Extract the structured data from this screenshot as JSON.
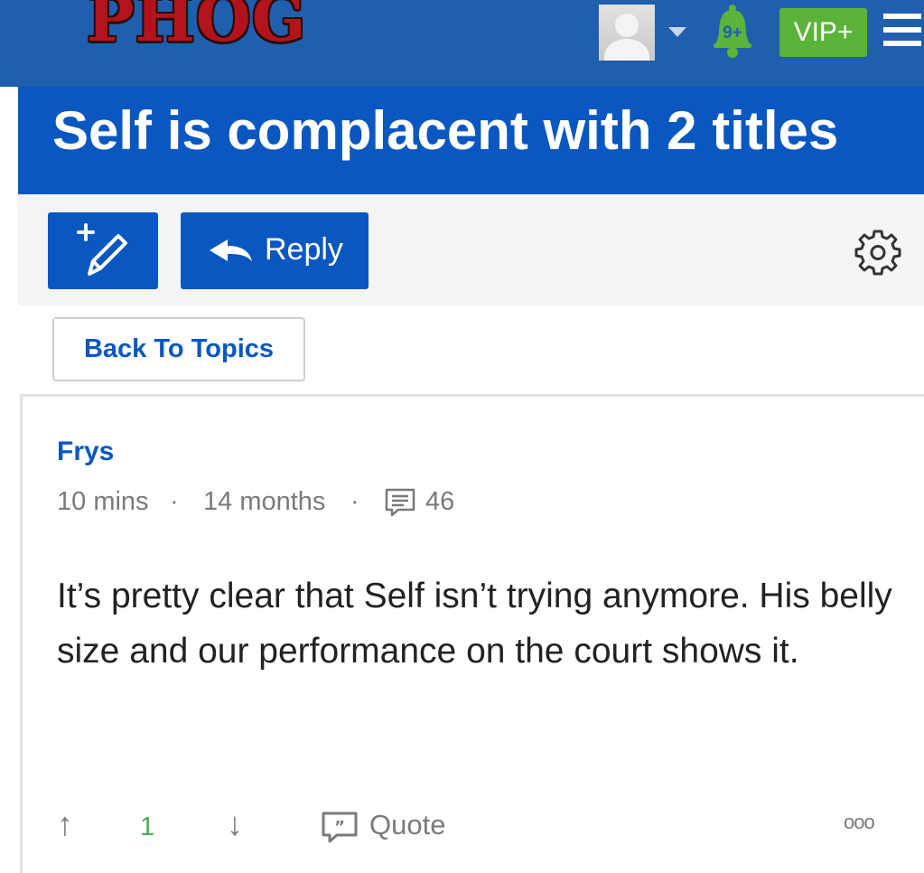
{
  "header": {
    "logo_text": "PHOG",
    "notification_count": "9+",
    "vip_label": "VIP+"
  },
  "thread": {
    "title": "Self is complacent with 2 titles"
  },
  "toolbar": {
    "reply_label": "Reply"
  },
  "navigation": {
    "back_label": "Back To Topics"
  },
  "post": {
    "author": "Frys",
    "posted_ago": "10 mins",
    "account_age": "14 months",
    "post_count": "46",
    "body": "It’s pretty clear that Self isn’t trying anymore. His belly size and our performance on the court shows it.",
    "vote_up_symbol": "↑",
    "vote_count": "1",
    "vote_down_symbol": "↓",
    "quote_label": "Quote",
    "more_symbol": "ooo"
  },
  "colors": {
    "header_blue": "#1f5fae",
    "primary_blue": "#0a57c2",
    "logo_red": "#b3141c",
    "vip_green": "#5bb339",
    "upvote_green": "#4caf50"
  },
  "icons": [
    "user-avatar",
    "chevron-down-icon",
    "bell-icon",
    "hamburger-menu-icon",
    "new-topic-pencil-icon",
    "reply-arrow-icon",
    "gear-icon",
    "comments-icon",
    "upvote-arrow-icon",
    "downvote-arrow-icon",
    "quote-icon",
    "more-options-icon"
  ]
}
